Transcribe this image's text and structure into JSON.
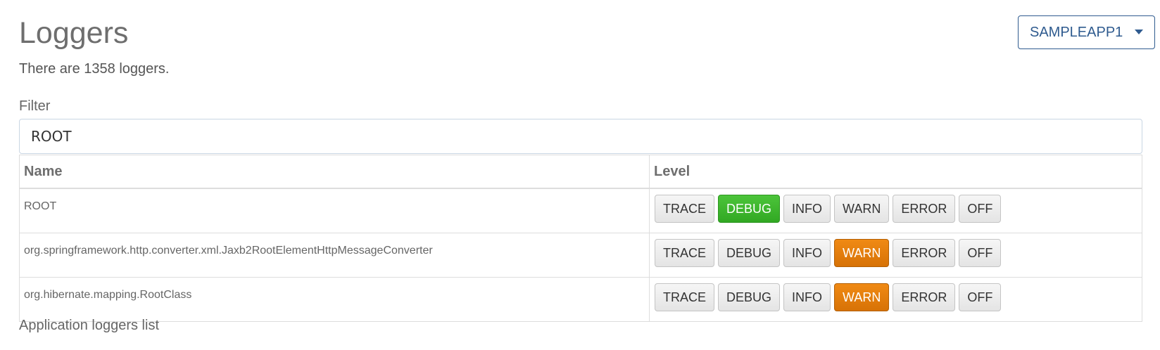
{
  "header": {
    "title": "Loggers",
    "app_selector": "SAMPLEAPP1",
    "count_text": "There are 1358 loggers."
  },
  "filter": {
    "label": "Filter",
    "value": "ROOT"
  },
  "table": {
    "columns": [
      "Name",
      "Level"
    ],
    "level_options": [
      "TRACE",
      "DEBUG",
      "INFO",
      "WARN",
      "ERROR",
      "OFF"
    ],
    "rows": [
      {
        "name": "ROOT",
        "active_level": "DEBUG"
      },
      {
        "name": "org.springframework.http.converter.xml.Jaxb2RootElementHttpMessageConverter",
        "active_level": "WARN"
      },
      {
        "name": "org.hibernate.mapping.RootClass",
        "active_level": "WARN"
      }
    ]
  },
  "footer": {
    "section_title": "Application loggers list"
  },
  "colors": {
    "debug_active": "#31a823",
    "warn_active": "#d77206",
    "selector_accent": "#2f5b8f"
  }
}
